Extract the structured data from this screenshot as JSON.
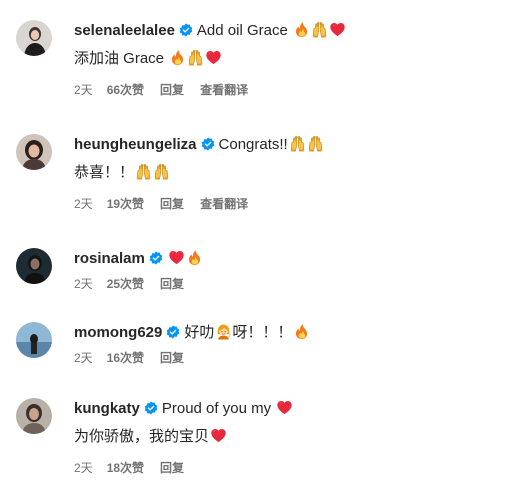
{
  "comments": [
    {
      "username": "selenaleelalee",
      "text": "Add oil Grace",
      "text_emojis": [
        "fire",
        "raised-hands",
        "red-heart"
      ],
      "second_line": "添加油 Grace",
      "second_emojis": [
        "fire",
        "raised-hands",
        "red-heart"
      ],
      "time": "2天",
      "likes": "66次赞",
      "reply": "回复",
      "translate": "查看翻译"
    },
    {
      "username": "heungheungeliza",
      "text": "Congrats!!",
      "text_emojis": [
        "raised-hands",
        "raised-hands"
      ],
      "second_line": "恭喜！！",
      "second_emojis": [
        "raised-hands",
        "raised-hands"
      ],
      "time": "2天",
      "likes": "19次赞",
      "reply": "回复",
      "translate": "查看翻译"
    },
    {
      "username": "rosinalam",
      "text": "",
      "text_emojis": [
        "red-heart",
        "fire"
      ],
      "time": "2天",
      "likes": "25次赞",
      "reply": "回复"
    },
    {
      "username": "momong629",
      "text": "好叻",
      "text_emojis": [
        "person-gesturing"
      ],
      "text_after": "呀！！！",
      "text_after_emojis": [
        "fire"
      ],
      "time": "2天",
      "likes": "16次赞",
      "reply": "回复"
    },
    {
      "username": "kungkaty",
      "text": "Proud of you my",
      "text_emojis": [
        "red-heart"
      ],
      "second_line": "为你骄傲，我的宝贝",
      "second_emojis": [
        "red-heart"
      ],
      "time": "2天",
      "likes": "18次赞",
      "reply": "回复"
    }
  ],
  "colors": {
    "verified": "#0095f6",
    "meta_text": "#737373",
    "heart": "#e8293d",
    "fire": "#f47a1f"
  }
}
